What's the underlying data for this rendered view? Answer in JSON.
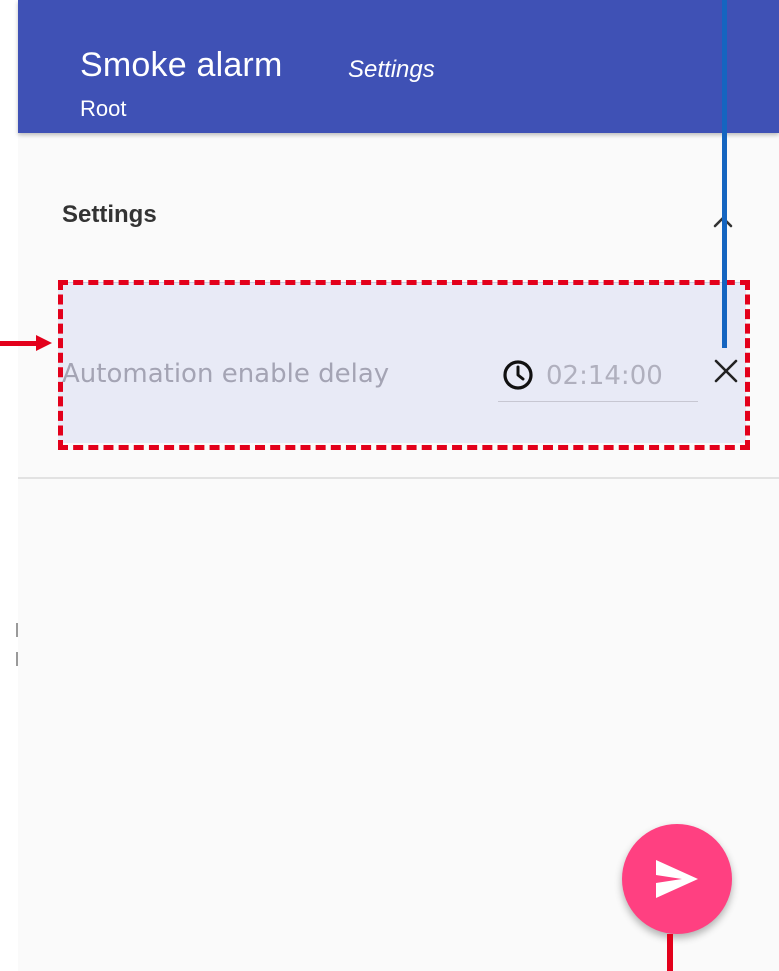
{
  "app_bar": {
    "title": "Smoke alarm",
    "subtitle": "Settings",
    "breadcrumb": "Root",
    "color": "#3f51b5"
  },
  "section": {
    "title": "Settings",
    "toggle_icon": "chevron-up-icon"
  },
  "setting_row": {
    "label": "Automation enable delay",
    "time_value": "02:14:00",
    "field_icon": "clock-icon",
    "clear_icon": "close-icon",
    "background": "#e8eaf6"
  },
  "fab": {
    "icon": "send-icon",
    "color": "#ff4081"
  },
  "annotations": {
    "highlight_color": "#e3001b",
    "pointer_color": "#1565c0"
  }
}
